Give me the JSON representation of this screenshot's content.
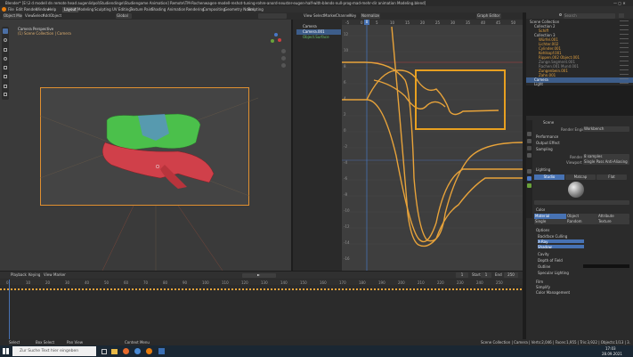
{
  "titlebar": {
    "title": "Blender* [E:\\3 d modell dn remote head augenlidpol\\Studiendinge\\Studiengame Animation] Remote\\TM-Rochenwagen-modell-reshot-tuning-rohre-anord-neuster-eugen-half-with-blends-null-prog-mad-mehr-dir animation Modeling.blend]"
  },
  "menu": [
    "File",
    "Edit",
    "Render",
    "Window",
    "Help"
  ],
  "workspaces": [
    "Layout",
    "Modeling",
    "Sculpting",
    "UV Editing",
    "Texture Paint",
    "Shading",
    "Animation",
    "Rendering",
    "Compositing",
    "Geometry Nodes",
    "Scripting"
  ],
  "viewport": {
    "mode": "Object Mode",
    "menus": [
      "View",
      "Select",
      "Add",
      "Object"
    ],
    "overlay_title": "Camera Perspective",
    "overlay_sub": "(1) Scene Collection | Camera",
    "orient": "Global"
  },
  "outliner_mini": {
    "items": [
      "Camera",
      "Camera.001",
      "Object.Surface"
    ]
  },
  "graph": {
    "menus": [
      "View",
      "Select",
      "Marker",
      "Channel",
      "Key"
    ],
    "mode": "Graph Editor",
    "normalize": "Normalize",
    "ticks": [
      "-5",
      "0",
      "5",
      "10",
      "15",
      "20",
      "25",
      "30",
      "35",
      "40",
      "45",
      "50"
    ],
    "current_frame": "0",
    "yticks": [
      "12",
      "10",
      "8",
      "6",
      "4",
      "2",
      "0",
      "-2",
      "-4",
      "-6",
      "-8",
      "-10",
      "-12",
      "-14",
      "-16"
    ]
  },
  "timeline": {
    "menus": [
      "Playback",
      "Keying",
      "View",
      "Marker"
    ],
    "start_label": "Start",
    "start": "1",
    "end_label": "End",
    "end": "250",
    "frame": "1",
    "ticks": [
      "0",
      "10",
      "20",
      "30",
      "40",
      "50",
      "60",
      "70",
      "80",
      "90",
      "100",
      "110",
      "120",
      "130",
      "140",
      "150",
      "160",
      "170",
      "180",
      "190",
      "200",
      "210",
      "220",
      "230",
      "240",
      "250"
    ]
  },
  "statusbar": {
    "left": [
      "Select",
      "Box Select",
      "Pan View",
      "Context Menu"
    ],
    "right": "Scene Collection | Camera | Verts:2,046 | Faces:1,955 | Tris:3,922 | Objects:1/13 | 3.0.0"
  },
  "outliner": {
    "search_placeholder": "Search",
    "items": [
      {
        "label": "Scene Collection",
        "indent": 0,
        "color": "#c9c9c9",
        "sel": false
      },
      {
        "label": "Collection 2",
        "indent": 1,
        "color": "#c9c9c9",
        "sel": false
      },
      {
        "label": "Schiff",
        "indent": 2,
        "color": "#e0a040",
        "sel": false
      },
      {
        "label": "Collection 3",
        "indent": 1,
        "color": "#c9c9c9",
        "sel": false
      },
      {
        "label": "Würfel.001",
        "indent": 2,
        "color": "#e0a040",
        "sel": false
      },
      {
        "label": "Lichter.002",
        "indent": 2,
        "color": "#e0a040",
        "sel": false
      },
      {
        "label": "Cylinder.001",
        "indent": 2,
        "color": "#e0a040",
        "sel": false
      },
      {
        "label": "Kehlkopf.001",
        "indent": 2,
        "color": "#e0a040",
        "sel": false
      },
      {
        "label": "Rippen.002 Object.001",
        "indent": 2,
        "color": "#e0a040",
        "sel": false
      },
      {
        "label": "Zunge.Segment.001",
        "indent": 2,
        "color": "#8a8a8a",
        "sel": false
      },
      {
        "label": "Rachen.001 Mund.001",
        "indent": 2,
        "color": "#8a8a8a",
        "sel": false
      },
      {
        "label": "Zungenbein.001",
        "indent": 2,
        "color": "#e0a040",
        "sel": false
      },
      {
        "label": "Zahn.001",
        "indent": 2,
        "color": "#e0a040",
        "sel": false
      },
      {
        "label": "Camera",
        "indent": 1,
        "color": "#ffffff",
        "sel": true
      },
      {
        "label": "Light",
        "indent": 1,
        "color": "#c9c9c9",
        "sel": false
      }
    ]
  },
  "properties": {
    "object": "Scene",
    "render_engine_label": "Render Engine",
    "render_engine": "Workbench",
    "sections": [
      "Performance",
      "Output Effect",
      "Sampling"
    ],
    "render_label": "Render",
    "render_val": "8 samples",
    "viewport_label": "Viewport",
    "viewport_val": "Single Pass Anti-Aliasing",
    "lighting_title": "Lighting",
    "lighting_opts": [
      "Studio",
      "Matcap",
      "Flat"
    ],
    "color_title": "Color",
    "color_opts": [
      "Material",
      "Object",
      "Attribute",
      "Single",
      "Random",
      "Texture"
    ],
    "options_title": "Options",
    "options": [
      "Backface Culling",
      "X-Ray",
      "Shadow",
      "Cavity",
      "Depth of Field",
      "Outline",
      "Specular Lighting"
    ],
    "footer_sections": [
      "Film",
      "Simplify",
      "Color Management"
    ]
  },
  "taskbar": {
    "search_placeholder": "Zur Suche Text hier eingeben",
    "time": "17:03",
    "date": "28.09.2021"
  },
  "accent": "#e8a33a",
  "highlight_box_color": "#e8a020"
}
